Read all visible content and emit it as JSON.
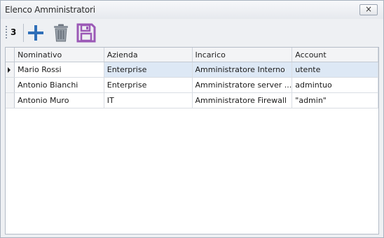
{
  "window": {
    "title": "Elenco Amministratori",
    "close_label": "×"
  },
  "toolbar": {
    "record_count": "3",
    "buttons": [
      {
        "icon": "plus-icon",
        "tooltip": ""
      },
      {
        "icon": "trash-icon",
        "tooltip": ""
      },
      {
        "icon": "save-icon",
        "tooltip": ""
      }
    ]
  },
  "grid": {
    "columns": [
      "Nominativo",
      "Azienda",
      "Incarico",
      "Account"
    ],
    "rows": [
      {
        "nominativo": "Mario Rossi",
        "azienda": "Enterprise",
        "incarico": "Amministratore Interno",
        "account": "utente",
        "selected": true
      },
      {
        "nominativo": "Antonio Bianchi",
        "azienda": "Enterprise",
        "incarico": "Amministratore server ...",
        "account": "admintuo",
        "selected": false
      },
      {
        "nominativo": "Antonio Muro",
        "azienda": "IT",
        "incarico": "Amministratore Firewall",
        "account": "\"admin\"",
        "selected": false
      }
    ]
  },
  "colors": {
    "accent_blue": "#2f6fb8",
    "save_purple": "#9b59b6",
    "selection": "#dde8f5"
  }
}
